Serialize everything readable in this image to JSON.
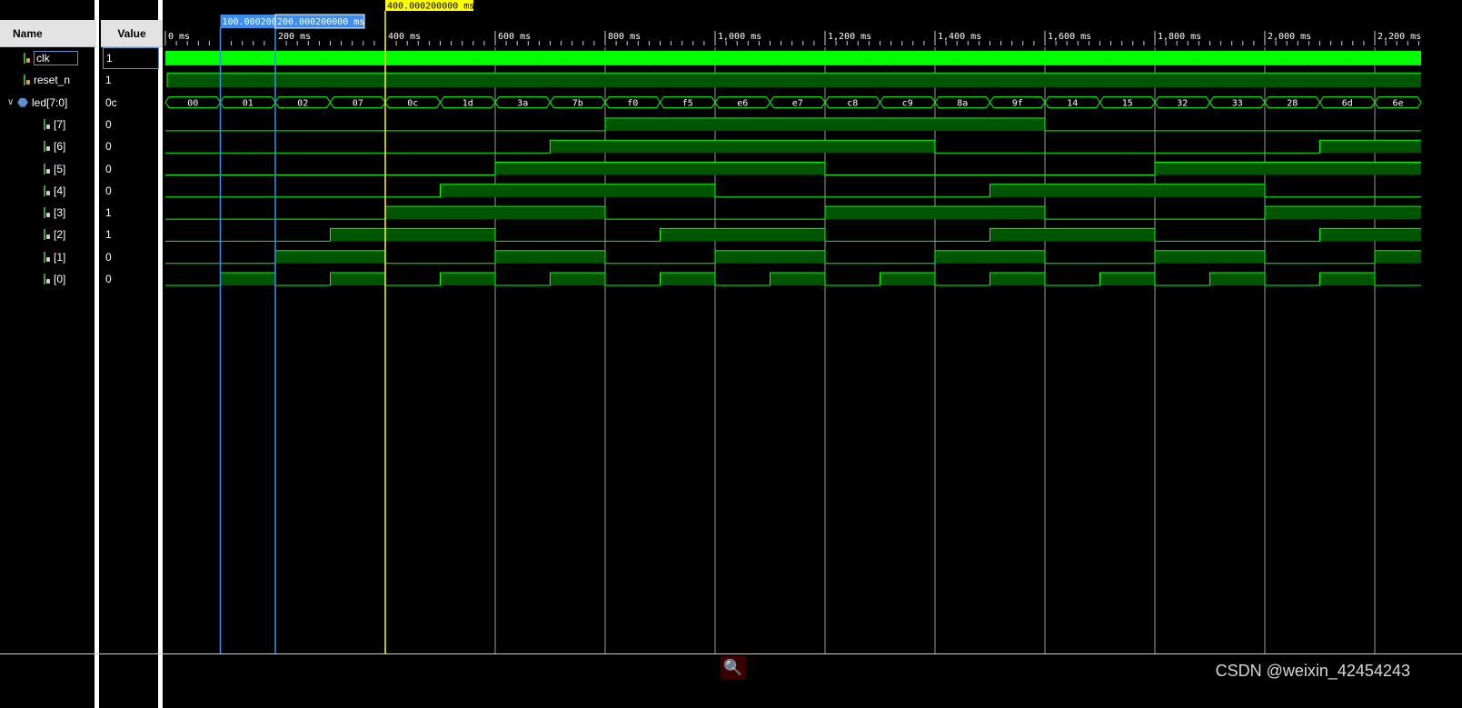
{
  "columns": {
    "name": "Name",
    "value": "Value"
  },
  "signals": [
    {
      "name": "clk",
      "value": "1",
      "kind": "bit"
    },
    {
      "name": "reset_n",
      "value": "1",
      "kind": "bit"
    },
    {
      "name": "led[7:0]",
      "value": "0c",
      "kind": "bus"
    },
    {
      "name": "[7]",
      "value": "0",
      "kind": "bit-child"
    },
    {
      "name": "[6]",
      "value": "0",
      "kind": "bit-child"
    },
    {
      "name": "[5]",
      "value": "0",
      "kind": "bit-child"
    },
    {
      "name": "[4]",
      "value": "0",
      "kind": "bit-child"
    },
    {
      "name": "[3]",
      "value": "1",
      "kind": "bit-child"
    },
    {
      "name": "[2]",
      "value": "1",
      "kind": "bit-child"
    },
    {
      "name": "[1]",
      "value": "0",
      "kind": "bit-child"
    },
    {
      "name": "[0]",
      "value": "0",
      "kind": "bit-child"
    }
  ],
  "time_axis": {
    "labels": [
      "0 ms",
      "200 ms",
      "400 ms",
      "600 ms",
      "800 ms",
      "1,000 ms",
      "1,200 ms",
      "1,400 ms",
      "1,600 ms",
      "1,800 ms",
      "2,000 ms",
      "2,200 ms"
    ],
    "major_ms": [
      0,
      200,
      400,
      600,
      800,
      1000,
      1200,
      1400,
      1600,
      1800,
      2000,
      2200
    ],
    "max_ms": 2280
  },
  "cursors": [
    {
      "label": "400.000200000 ms",
      "time_ms": 400,
      "color": "#ffff00"
    },
    {
      "label": "100.000200",
      "time_ms": 100,
      "color": "#3a8ff0"
    },
    {
      "label": "200.000200000 ms",
      "time_ms": 200,
      "color": "#3a8ff0"
    }
  ],
  "bus_values": [
    "00",
    "01",
    "02",
    "07",
    "0c",
    "1d",
    "3a",
    "7b",
    "f0",
    "f5",
    "e6",
    "e7",
    "c8",
    "c9",
    "8a",
    "9f",
    "14",
    "15",
    "32",
    "33",
    "28",
    "6d",
    "6e"
  ],
  "colors": {
    "wave": "#00ff00",
    "wave_fill": "#005500",
    "grid": "#9a9a9a"
  },
  "watermark": "CSDN @weixin_42454243",
  "search_icon": "search-icon"
}
